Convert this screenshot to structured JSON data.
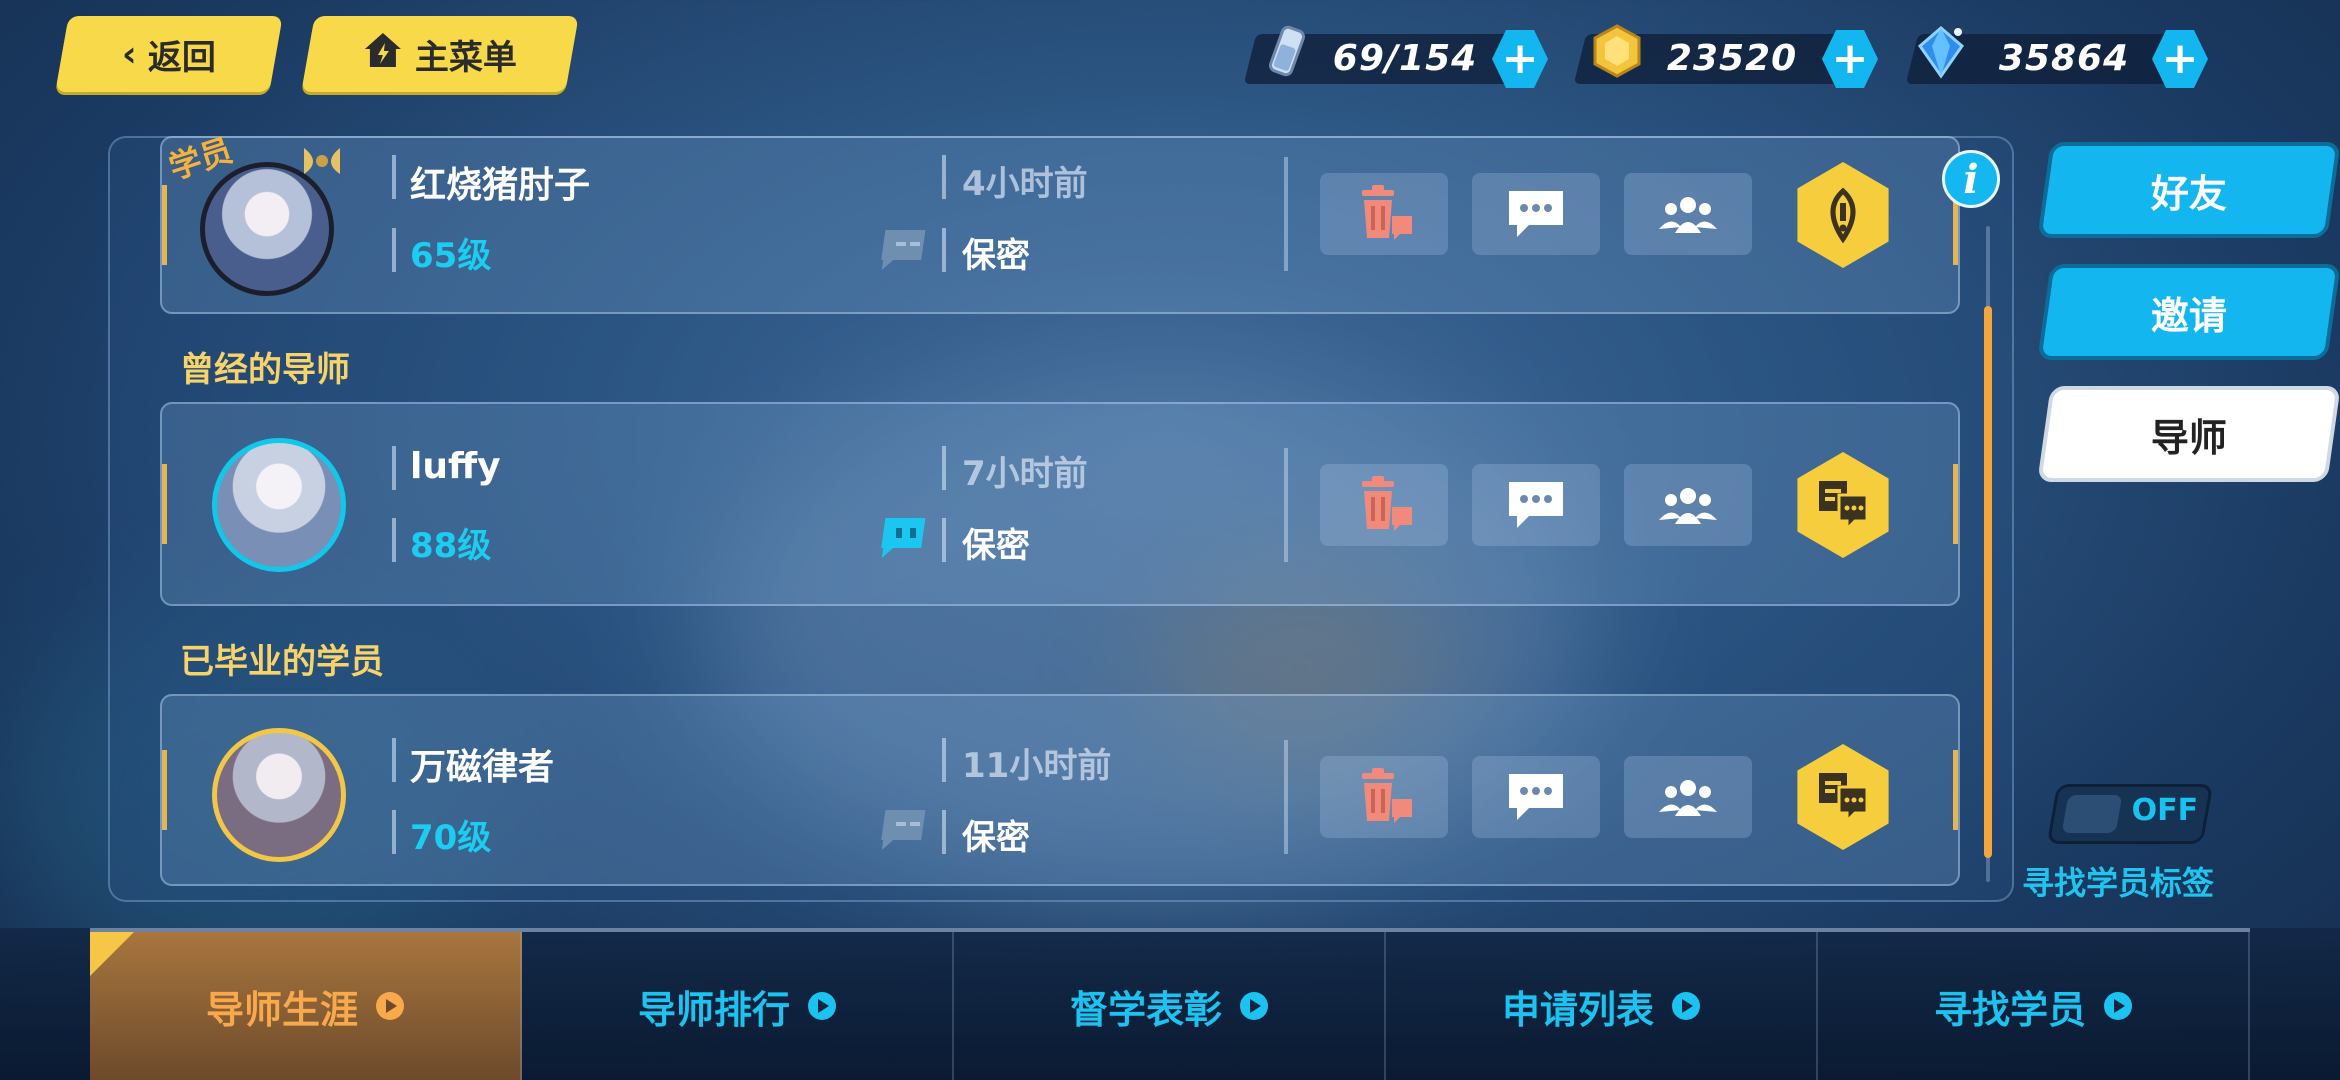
{
  "nav": {
    "back_label": "返回",
    "menu_label": "主菜单"
  },
  "resources": [
    {
      "icon": "stamina-icon",
      "value": "69/154"
    },
    {
      "icon": "coin-icon",
      "value": "23520"
    },
    {
      "icon": "crystal-icon",
      "value": "35864"
    }
  ],
  "sections": {
    "former_mentors": "曾经的导师",
    "graduated_students": "已毕业的学员"
  },
  "rows": [
    {
      "badge": "学员",
      "name": "红烧猪肘子",
      "level": "65级",
      "time": "4小时前",
      "privacy": "保密"
    },
    {
      "name": "luffy",
      "level": "88级",
      "time": "7小时前",
      "privacy": "保密"
    },
    {
      "name": "万磁律者",
      "level": "70级",
      "time": "11小时前",
      "privacy": "保密"
    }
  ],
  "side_tabs": [
    "好友",
    "邀请",
    "导师"
  ],
  "toggle": {
    "state": "OFF",
    "caption": "寻找学员标签"
  },
  "bottom_tabs": [
    "导师生涯",
    "导师排行",
    "督学表彰",
    "申请列表",
    "寻找学员"
  ],
  "colors": {
    "accent_yellow": "#f7d94a",
    "accent_blue": "#14b6f0",
    "level_cyan": "#1ccdf2",
    "active_tab": "#f7a94b"
  }
}
